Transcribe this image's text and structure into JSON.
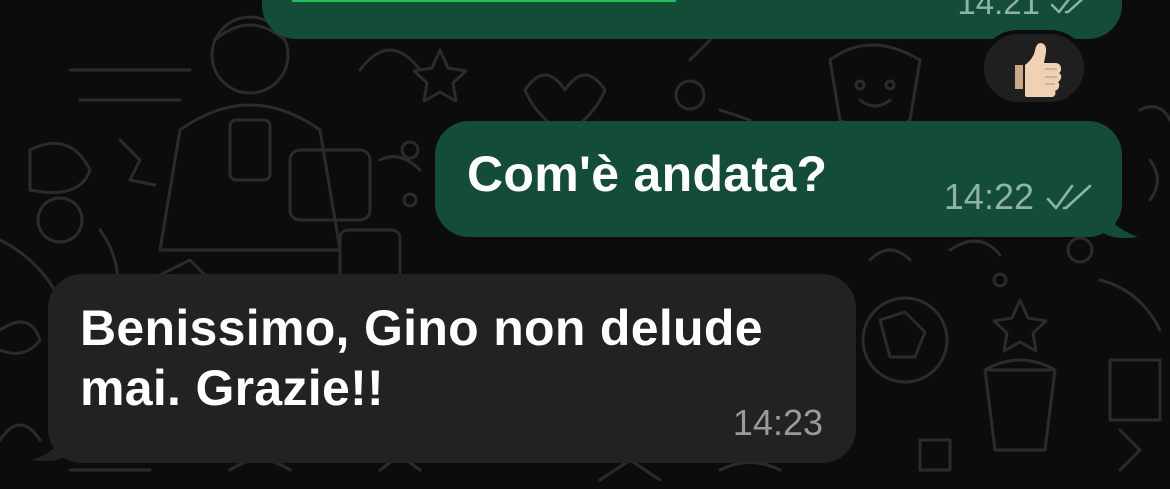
{
  "colors": {
    "outgoing_bubble": "#144d37",
    "incoming_bubble": "#222222",
    "background": "#0c0c0c",
    "link_preview_bar": "#25c15a",
    "meta_outgoing": "#8fb3a3",
    "meta_incoming": "#9a9a9a"
  },
  "messages": [
    {
      "direction": "outgoing",
      "time": "14:21",
      "status": "double-check-read-icon",
      "partially_visible": true
    },
    {
      "direction": "outgoing",
      "text": "Com'è andata?",
      "time": "14:22",
      "status": "double-check-read-icon"
    },
    {
      "direction": "incoming",
      "text": "Benissimo, Gino non delude mai. Grazie!!",
      "time": "14:23"
    }
  ],
  "reaction": {
    "emoji": "👍🏼",
    "icon": "thumbs-up-icon"
  }
}
